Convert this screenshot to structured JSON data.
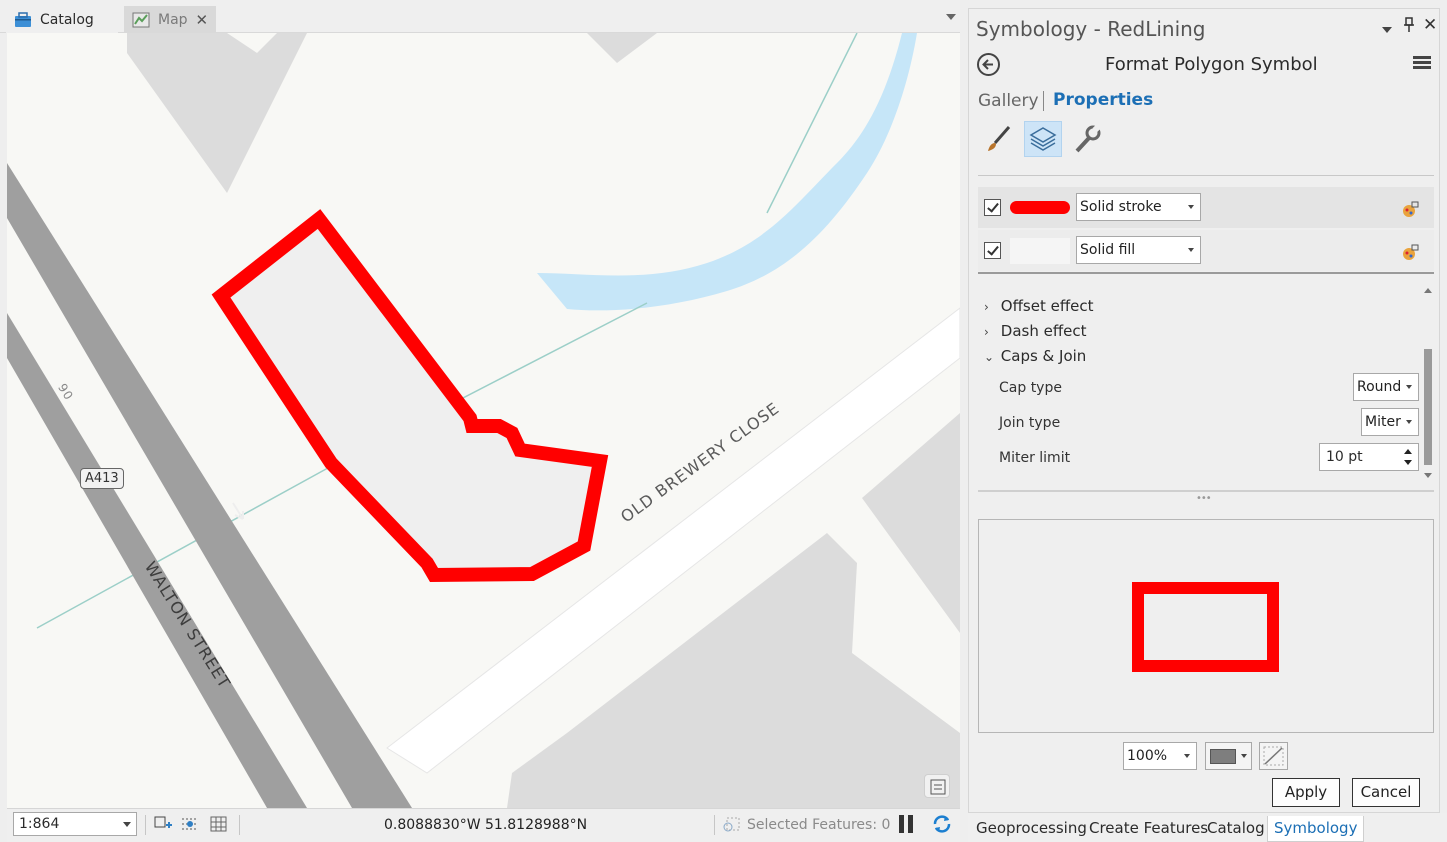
{
  "tabs": {
    "catalog": "Catalog",
    "map": "Map"
  },
  "map": {
    "street_old_brewery": "OLD BREWERY CLOSE",
    "street_walton": "WALTON STREET",
    "road_shield": "A413",
    "house_number": "90",
    "polygon_color": "#ff0000"
  },
  "status": {
    "scale": "1:864",
    "coordinates": "0.8088830°W 51.8128988°N",
    "selected_features": "Selected Features: 0"
  },
  "pane": {
    "title": "Symbology - RedLining",
    "subtitle": "Format Polygon Symbol",
    "tab_gallery": "Gallery",
    "tab_properties": "Properties",
    "layers": [
      {
        "checked": true,
        "type": "Solid stroke",
        "swatch_color": "#ff0000"
      },
      {
        "checked": true,
        "type": "Solid fill",
        "swatch_color": "#f5f5f5"
      }
    ],
    "sections": {
      "offset_effect": "Offset effect",
      "dash_effect": "Dash effect",
      "caps_join": "Caps & Join"
    },
    "props": {
      "cap_type_label": "Cap type",
      "cap_type_value": "Round",
      "join_type_label": "Join type",
      "join_type_value": "Miter",
      "miter_limit_label": "Miter limit",
      "miter_limit_value": "10 pt"
    },
    "preview_zoom": "100%",
    "apply": "Apply",
    "cancel": "Cancel"
  },
  "bottom_tabs": [
    "Geoprocessing",
    "Create Features",
    "Catalog",
    "Symbology"
  ],
  "accent_color": "#1c6fb5"
}
